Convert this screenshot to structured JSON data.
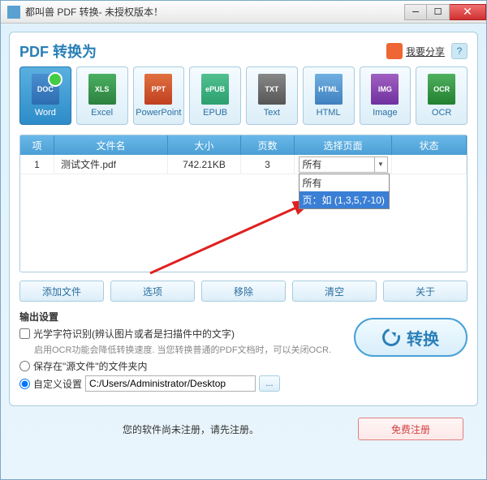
{
  "titlebar": {
    "text": "都叫兽 PDF 转换- 未授权版本！"
  },
  "header": {
    "title": "PDF 转换为",
    "share": "我要分享"
  },
  "formats": [
    {
      "id": "word",
      "label": "Word",
      "icon": "doc",
      "iconText": "DOC",
      "active": true
    },
    {
      "id": "excel",
      "label": "Excel",
      "icon": "xls",
      "iconText": "XLS"
    },
    {
      "id": "ppt",
      "label": "PowerPoint",
      "icon": "ppt",
      "iconText": "PPT"
    },
    {
      "id": "epub",
      "label": "EPUB",
      "icon": "epub",
      "iconText": "ePUB"
    },
    {
      "id": "text",
      "label": "Text",
      "icon": "txt",
      "iconText": "TXT"
    },
    {
      "id": "html",
      "label": "HTML",
      "icon": "html",
      "iconText": "HTML"
    },
    {
      "id": "image",
      "label": "Image",
      "icon": "img",
      "iconText": "IMG"
    },
    {
      "id": "ocr",
      "label": "OCR",
      "icon": "ocr",
      "iconText": "OCR"
    }
  ],
  "table": {
    "headers": {
      "idx": "项",
      "name": "文件名",
      "size": "大小",
      "pages": "页数",
      "select": "选择页面",
      "status": "状态"
    },
    "rows": [
      {
        "idx": "1",
        "name": "测试文件.pdf",
        "size": "742.21KB",
        "pages": "3",
        "select": "所有",
        "status": ""
      }
    ]
  },
  "dropdown": {
    "options": [
      {
        "label": "所有",
        "selected": false
      },
      {
        "label": "页：如 (1,3,5,7-10)",
        "selected": true
      }
    ]
  },
  "buttons": {
    "add": "添加文件",
    "options": "选项",
    "remove": "移除",
    "clear": "清空",
    "about": "关于"
  },
  "output": {
    "title": "输出设置",
    "ocr_label": "光学字符识别(辨认图片或者是扫描件中的文字)",
    "ocr_hint": "启用OCR功能会降低转换速度. 当您转换普通的PDF文档时，可以关闭OCR.",
    "save_src": "保存在\"源文件\"的文件夹内",
    "custom": "自定义设置",
    "path": "C:/Users/Administrator/Desktop"
  },
  "convert": {
    "label": "转换"
  },
  "footer": {
    "text": "您的软件尚未注册，请先注册。",
    "register": "免费注册"
  }
}
